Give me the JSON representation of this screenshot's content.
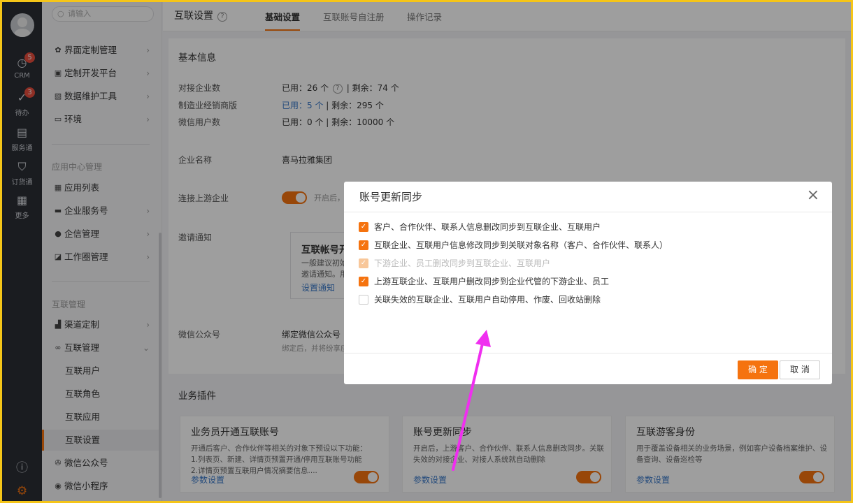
{
  "nav": {
    "crm": {
      "label": "CRM",
      "badge": "5"
    },
    "todo": {
      "label": "待办",
      "badge": "3"
    },
    "service": {
      "label": "服务通"
    },
    "order": {
      "label": "订货通"
    },
    "more": {
      "label": "更多"
    }
  },
  "sidebar": {
    "search_placeholder": "请输入",
    "top_items": [
      {
        "label": "界面定制管理"
      },
      {
        "label": "定制开发平台"
      },
      {
        "label": "数据维护工具"
      },
      {
        "label": "环境"
      }
    ],
    "app_group": "应用中心管理",
    "app_items": [
      {
        "label": "应用列表"
      },
      {
        "label": "企业服务号"
      },
      {
        "label": "企信管理"
      },
      {
        "label": "工作圈管理"
      }
    ],
    "link_group": "互联管理",
    "link_items": [
      {
        "label": "渠道定制"
      },
      {
        "label": "互联管理"
      }
    ],
    "link_subitems": [
      {
        "label": "互联用户"
      },
      {
        "label": "互联角色"
      },
      {
        "label": "互联应用"
      },
      {
        "label": "互联设置"
      }
    ],
    "bottom_items": [
      {
        "label": "微信公众号"
      },
      {
        "label": "微信小程序"
      }
    ]
  },
  "header": {
    "title": "互联设置",
    "help": "?",
    "tabs": [
      {
        "label": "基础设置"
      },
      {
        "label": "互联账号自注册"
      },
      {
        "label": "操作记录"
      }
    ]
  },
  "basic": {
    "section_title": "基本信息",
    "rows": [
      {
        "label": "对接企业数",
        "used": "已用：26 个",
        "help": "?",
        "rest": "| 剩余：74 个"
      },
      {
        "label": "制造业经销商版",
        "used": "已用：5 个",
        "rest": "| 剩余：295 个"
      },
      {
        "label": "微信用户数",
        "used": "已用：0 个",
        "rest": "| 剩余：10000 个"
      }
    ],
    "company_label": "企业名称",
    "company_value": "喜马拉雅集团",
    "upstream_label": "连接上游企业",
    "upstream_hint": "开启后，",
    "invite_label": "邀请通知",
    "invite_box_title": "互联帐号开",
    "invite_box_line1": "一般建议初始",
    "invite_box_line2": "邀请通知。用",
    "invite_box_link": "设置通知",
    "wechat_label": "微信公众号",
    "wechat_value": "绑定微信公众号",
    "wechat_hint": "绑定后，并将纷享应"
  },
  "plugins": {
    "section_title": "业务插件",
    "cards": [
      {
        "title": "业务员开通互联账号",
        "desc": "开通后客户、合作伙伴等相关的对象下预设以下功能：\n1.列表页、新建、详情页预置开通/停用互联账号功能\n2.详情页预置互联用户情况摘要信息....",
        "link": "参数设置"
      },
      {
        "title": "账号更新同步",
        "desc": "开启后，上游客户、合作伙伴、联系人信息删改同步。关联失效的对接企业、对接人系统就自动删除",
        "link": "参数设置"
      },
      {
        "title": "互联游客身份",
        "desc": "用于覆盖设备相关的业务场景，例如客户设备档案维护、设备查询、设备巡检等",
        "link": "参数设置"
      }
    ]
  },
  "modal": {
    "title": "账号更新同步",
    "close": "×",
    "options": [
      {
        "label": "客户、合作伙伴、联系人信息删改同步到互联企业、互联用户",
        "state": "checked"
      },
      {
        "label": "互联企业、互联用户信息修改同步到关联对象名称（客户、合作伙伴、联系人）",
        "state": "checked"
      },
      {
        "label": "下游企业、员工删改同步到互联企业、互联用户",
        "state": "disabled"
      },
      {
        "label": "上游互联企业、互联用户删改同步到企业代管的下游企业、员工",
        "state": "checked"
      },
      {
        "label": "关联失效的互联企业、互联用户自动停用、作废、回收站删除",
        "state": "unchecked"
      }
    ],
    "ok_label": "确 定",
    "cancel_label": "取 消"
  },
  "colors": {
    "accent": "#f5730f",
    "link": "#3b79c8",
    "arrow": "#f02ef0",
    "frame": "#f5c518"
  }
}
